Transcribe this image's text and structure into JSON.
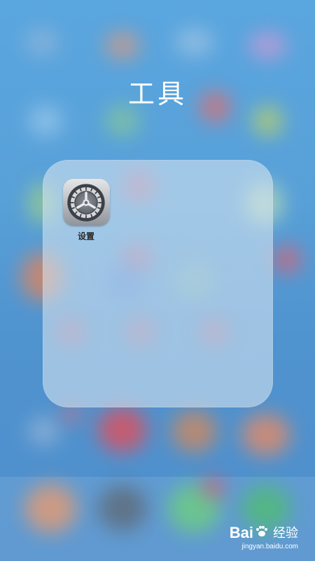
{
  "folder": {
    "title": "工具",
    "apps": [
      {
        "label": "设置",
        "icon": "settings-gear-icon"
      }
    ]
  },
  "watermark": {
    "brand_left": "Bai",
    "brand_right": "经验",
    "url": "jingyan.baidu.com"
  }
}
